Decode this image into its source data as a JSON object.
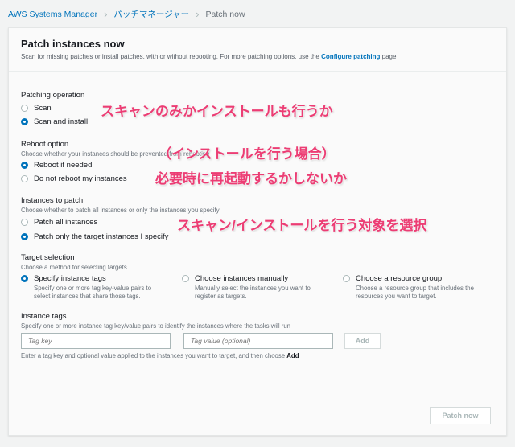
{
  "breadcrumb": {
    "items": [
      "AWS Systems Manager",
      "パッチマネージャー"
    ],
    "current": "Patch now"
  },
  "header": {
    "title": "Patch instances now",
    "subtitle": "Scan for missing patches or install patches, with or without rebooting. For more patching options, use the ",
    "link": "Configure patching",
    "subtitle_end": " page"
  },
  "patching_operation": {
    "label": "Patching operation",
    "options": [
      "Scan",
      "Scan and install"
    ],
    "selected": 1
  },
  "reboot_option": {
    "label": "Reboot option",
    "description": "Choose whether your instances should be prevented from rebooting",
    "options": [
      "Reboot if needed",
      "Do not reboot my instances"
    ],
    "selected": 0
  },
  "instances_to_patch": {
    "label": "Instances to patch",
    "description": "Choose whether to patch all instances or only the instances you specify",
    "options": [
      "Patch all instances",
      "Patch only the target instances I specify"
    ],
    "selected": 1
  },
  "target_selection": {
    "label": "Target selection",
    "description": "Choose a method for selecting targets.",
    "options": [
      {
        "label": "Specify instance tags",
        "description": "Specify one or more tag key-value pairs to select instances that share those tags."
      },
      {
        "label": "Choose instances manually",
        "description": "Manually select the instances you want to register as targets."
      },
      {
        "label": "Choose a resource group",
        "description": "Choose a resource group that includes the resources you want to target."
      }
    ],
    "selected": 0
  },
  "instance_tags": {
    "label": "Instance tags",
    "description": "Specify one or more instance tag key/value pairs to identify the instances where the tasks will run",
    "key_placeholder": "Tag key",
    "value_placeholder": "Tag value (optional)",
    "add_label": "Add",
    "hint": "Enter a tag key and optional value applied to the instances you want to target, and then choose ",
    "hint_bold": "Add"
  },
  "patch_now_label": "Patch now",
  "annotations": [
    "スキャンのみかインストールも行うか",
    "（インストールを行う場合）",
    "必要時に再起動するかしないか",
    "スキャン/インストールを行う対象を選択"
  ],
  "colors": {
    "accent": "#0073bb",
    "annotation": "#ec3d74"
  }
}
